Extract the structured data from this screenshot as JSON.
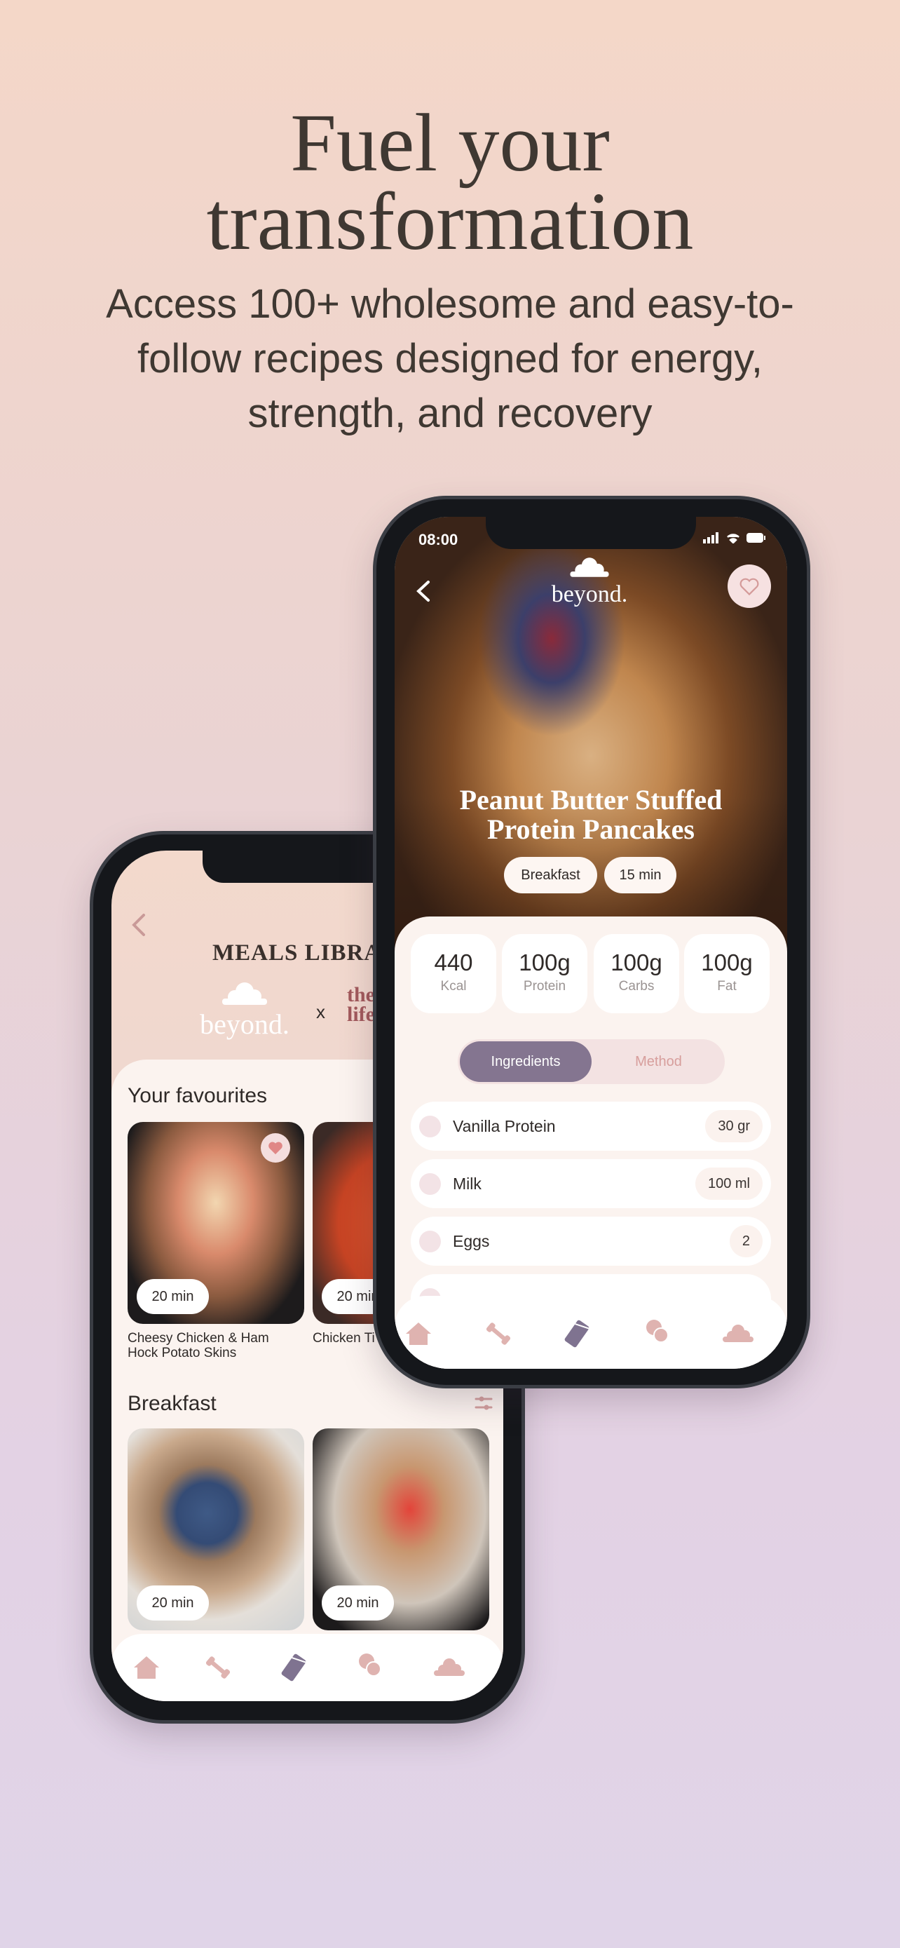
{
  "hero": {
    "title_line1": "Fuel your",
    "title_line2": "transformation",
    "subtitle_line1": "Access 100+ wholesome and easy-to-",
    "subtitle_line2": "follow recipes designed for energy,",
    "subtitle_line3": "strength, and recovery"
  },
  "colors": {
    "accent_purple": "#7f7390",
    "accent_pink": "#d9a6a4",
    "text": "#3f3832"
  },
  "library_screen": {
    "title": "MEALS LIBRARY",
    "brand": "beyond.",
    "collab_mark": "x",
    "partner_logo": "the good life",
    "favourites_heading": "Your favourites",
    "favourites": [
      {
        "time": "20 min",
        "name_line1": "Cheesy Chicken & Ham",
        "name_line2": "Hock Potato Skins",
        "favourited": true
      },
      {
        "time": "20 min",
        "name_line1": "Chicken Ti",
        "name_line2": ""
      }
    ],
    "breakfast_heading": "Breakfast",
    "breakfast": [
      {
        "time": "20 min"
      },
      {
        "time": "20 min"
      }
    ],
    "nav": [
      "home-icon",
      "dumbbell-icon",
      "meals-icon",
      "chat-icon",
      "cloud-icon"
    ],
    "active_nav": "meals-icon"
  },
  "recipe_screen": {
    "status_time": "08:00",
    "brand": "beyond.",
    "title_line1": "Peanut Butter Stuffed",
    "title_line2": "Protein Pancakes",
    "tags": [
      "Breakfast",
      "15 min"
    ],
    "nutrition": [
      {
        "value": "440",
        "label": "Kcal"
      },
      {
        "value": "100g",
        "label": "Protein"
      },
      {
        "value": "100g",
        "label": "Carbs"
      },
      {
        "value": "100g",
        "label": "Fat"
      }
    ],
    "tabs": {
      "active": "Ingredients",
      "inactive": "Method"
    },
    "ingredients": [
      {
        "name": "Vanilla Protein",
        "qty": "30 gr"
      },
      {
        "name": "Milk",
        "qty": "100 ml"
      },
      {
        "name": "Eggs",
        "qty": "2"
      }
    ],
    "nav": [
      "home-icon",
      "dumbbell-icon",
      "meals-icon",
      "chat-icon",
      "cloud-icon"
    ],
    "active_nav": "meals-icon"
  }
}
